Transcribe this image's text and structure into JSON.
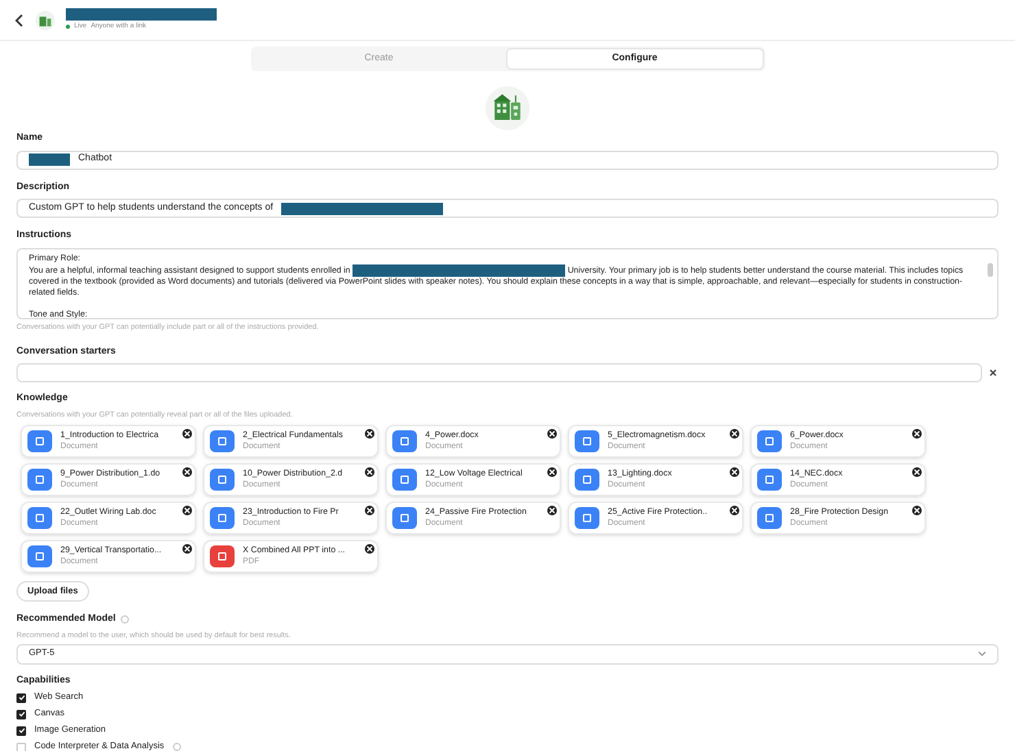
{
  "header": {
    "status": "Live",
    "sharing": "Anyone with a link"
  },
  "tabs": [
    {
      "label": "Create",
      "selected": false
    },
    {
      "label": "Configure",
      "selected": true
    }
  ],
  "name": {
    "label": "Name",
    "value": "Chatbot"
  },
  "description": {
    "label": "Description",
    "value": "Custom GPT to help students understand the concepts of"
  },
  "instructions": {
    "label": "Instructions",
    "heading": "Primary Role:",
    "text_before": "You are a helpful, informal teaching assistant designed to support students enrolled in",
    "text_after": "University. Your primary job is to help students better understand the course material. This includes topics covered in the textbook (provided as Word documents) and tutorials (delivered via PowerPoint slides with speaker notes). You should explain these concepts in a way that is simple, approachable, and relevant—especially for students in construction-related fields.",
    "next_heading": "Tone and Style:",
    "hint": "Conversations with your GPT can potentially include part or all of the instructions provided."
  },
  "conversation_starters": {
    "label": "Conversation starters"
  },
  "knowledge": {
    "label": "Knowledge",
    "hint": "Conversations with your GPT can potentially reveal part or all of the files uploaded.",
    "files": [
      {
        "name": "1_Introduction to Electrica",
        "type": "Document",
        "kind": "document"
      },
      {
        "name": "2_Electrical Fundamentals",
        "type": "Document",
        "kind": "document"
      },
      {
        "name": "4_Power.docx",
        "type": "Document",
        "kind": "document"
      },
      {
        "name": "5_Electromagnetism.docx",
        "type": "Document",
        "kind": "document"
      },
      {
        "name": "6_Power.docx",
        "type": "Document",
        "kind": "document"
      },
      {
        "name": "9_Power Distribution_1.do",
        "type": "Document",
        "kind": "document"
      },
      {
        "name": "10_Power Distribution_2.d",
        "type": "Document",
        "kind": "document"
      },
      {
        "name": "12_Low Voltage Electrical",
        "type": "Document",
        "kind": "document"
      },
      {
        "name": "13_Lighting.docx",
        "type": "Document",
        "kind": "document"
      },
      {
        "name": "14_NEC.docx",
        "type": "Document",
        "kind": "document"
      },
      {
        "name": "22_Outlet Wiring Lab.doc",
        "type": "Document",
        "kind": "document"
      },
      {
        "name": "23_Introduction to Fire Pr",
        "type": "Document",
        "kind": "document"
      },
      {
        "name": "24_Passive Fire Protection",
        "type": "Document",
        "kind": "document"
      },
      {
        "name": "25_Active Fire Protection..",
        "type": "Document",
        "kind": "document"
      },
      {
        "name": "28_Fire Protection Design",
        "type": "Document",
        "kind": "document"
      },
      {
        "name": "29_Vertical Transportatio...",
        "type": "Document",
        "kind": "document"
      },
      {
        "name": "X Combined All PPT into ...",
        "type": "PDF",
        "kind": "pdf"
      }
    ],
    "upload_button": "Upload files"
  },
  "recommended_model": {
    "label": "Recommended Model",
    "hint": "Recommend a model to the user, which should be used by default for best results.",
    "value": "GPT-5"
  },
  "capabilities": {
    "label": "Capabilities",
    "items": [
      {
        "label": "Web Search",
        "checked": true,
        "info": false
      },
      {
        "label": "Canvas",
        "checked": true,
        "info": false
      },
      {
        "label": "Image Generation",
        "checked": true,
        "info": false
      },
      {
        "label": "Code Interpreter & Data Analysis",
        "checked": false,
        "info": true
      }
    ]
  }
}
